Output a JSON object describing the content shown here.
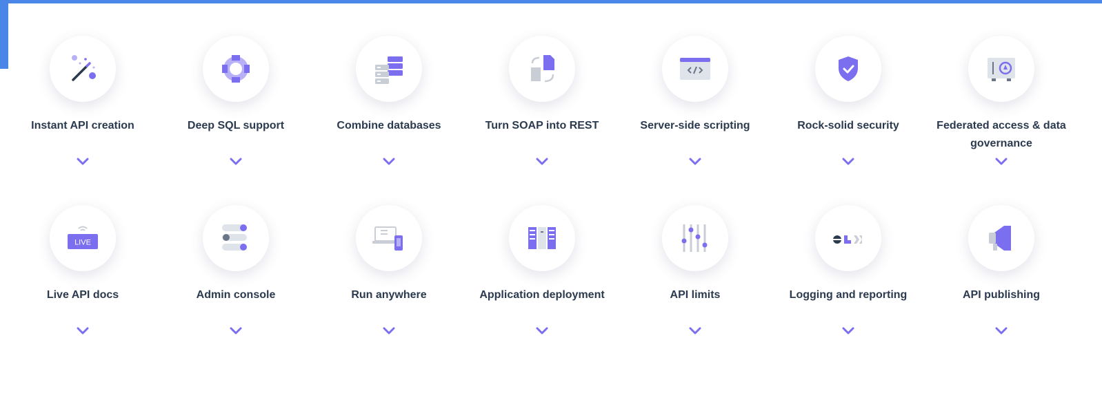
{
  "colors": {
    "accent": "#7b6ff0",
    "accent_light": "#b8b1f7",
    "gray": "#c9ced6",
    "text": "#2b3a4f",
    "top_bar": "#4a86e8"
  },
  "rows": [
    {
      "features": [
        {
          "label": "Instant API creation",
          "icon": "magic-wand-icon"
        },
        {
          "label": "Deep SQL support",
          "icon": "lifebuoy-icon"
        },
        {
          "label": "Combine databases",
          "icon": "database-servers-icon"
        },
        {
          "label": "Turn SOAP into REST",
          "icon": "document-convert-icon"
        },
        {
          "label": "Server-side scripting",
          "icon": "code-window-icon"
        },
        {
          "label": "Rock-solid security",
          "icon": "shield-check-icon"
        },
        {
          "label": "Federated access & data governance",
          "icon": "safe-vault-icon"
        }
      ]
    },
    {
      "features": [
        {
          "label": "Live API docs",
          "icon": "live-badge-icon"
        },
        {
          "label": "Admin console",
          "icon": "toggles-icon"
        },
        {
          "label": "Run anywhere",
          "icon": "devices-icon"
        },
        {
          "label": "Application deployment",
          "icon": "app-panels-icon"
        },
        {
          "label": "API limits",
          "icon": "sliders-icon"
        },
        {
          "label": "Logging and reporting",
          "icon": "elk-logo-icon"
        },
        {
          "label": "API publishing",
          "icon": "megaphone-icon"
        }
      ]
    }
  ]
}
